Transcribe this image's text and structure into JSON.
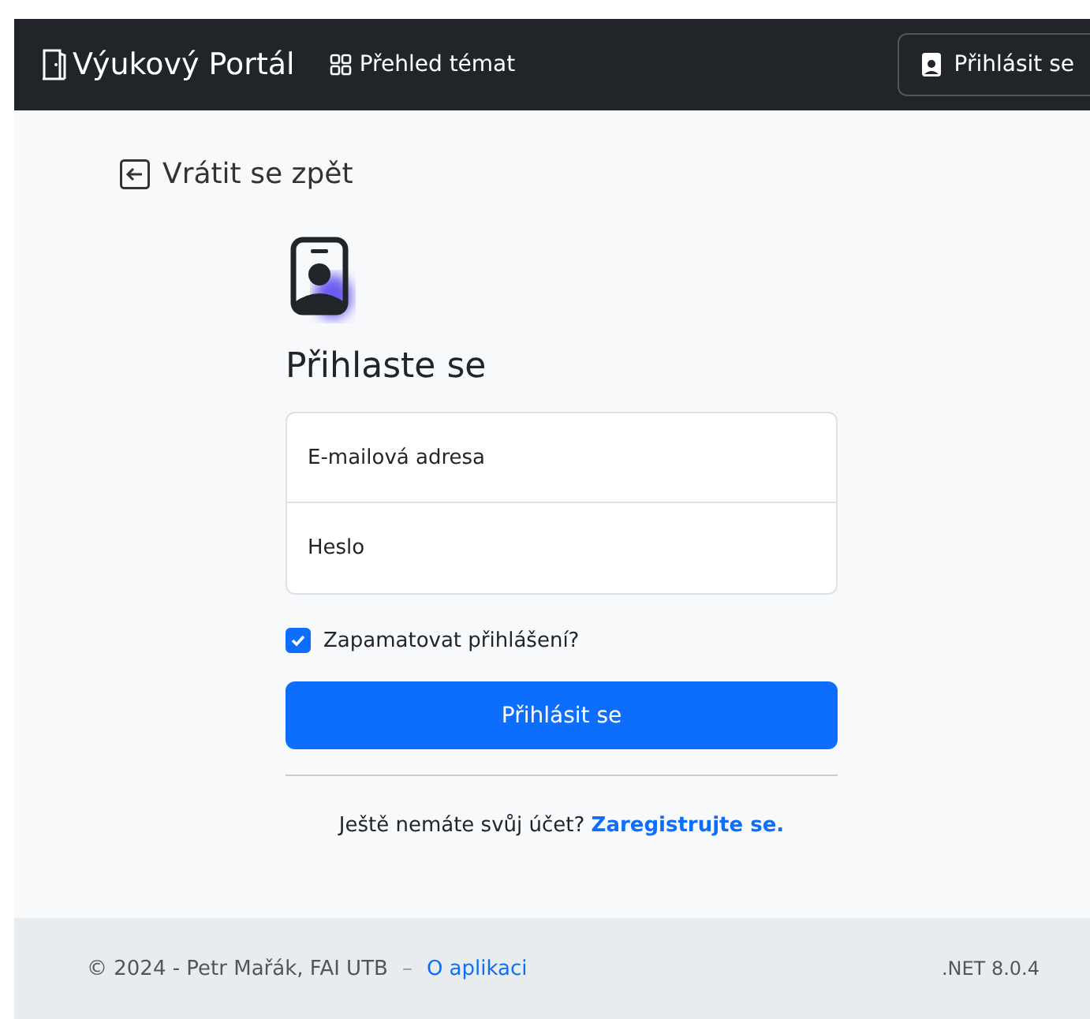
{
  "navbar": {
    "brand": "Výukový Portál",
    "links": [
      {
        "label": "Přehled témat"
      }
    ],
    "login_button": "Přihlásit se"
  },
  "back_link": "Vrátit se zpět",
  "form": {
    "title": "Přihlaste se",
    "fields": [
      {
        "placeholder": "E-mailová adresa"
      },
      {
        "placeholder": "Heslo"
      }
    ],
    "remember": {
      "label": "Zapamatovat přihlášení?",
      "checked": true
    },
    "submit": "Přihlásit se",
    "register_text": "Ještě nemáte svůj účet?",
    "register_link": "Zaregistrujte se."
  },
  "footer": {
    "copyright": "© 2024 - Petr Mařák, FAI UTB",
    "separator": "–",
    "about_link": "O aplikaci",
    "version": ".NET 8.0.4"
  }
}
